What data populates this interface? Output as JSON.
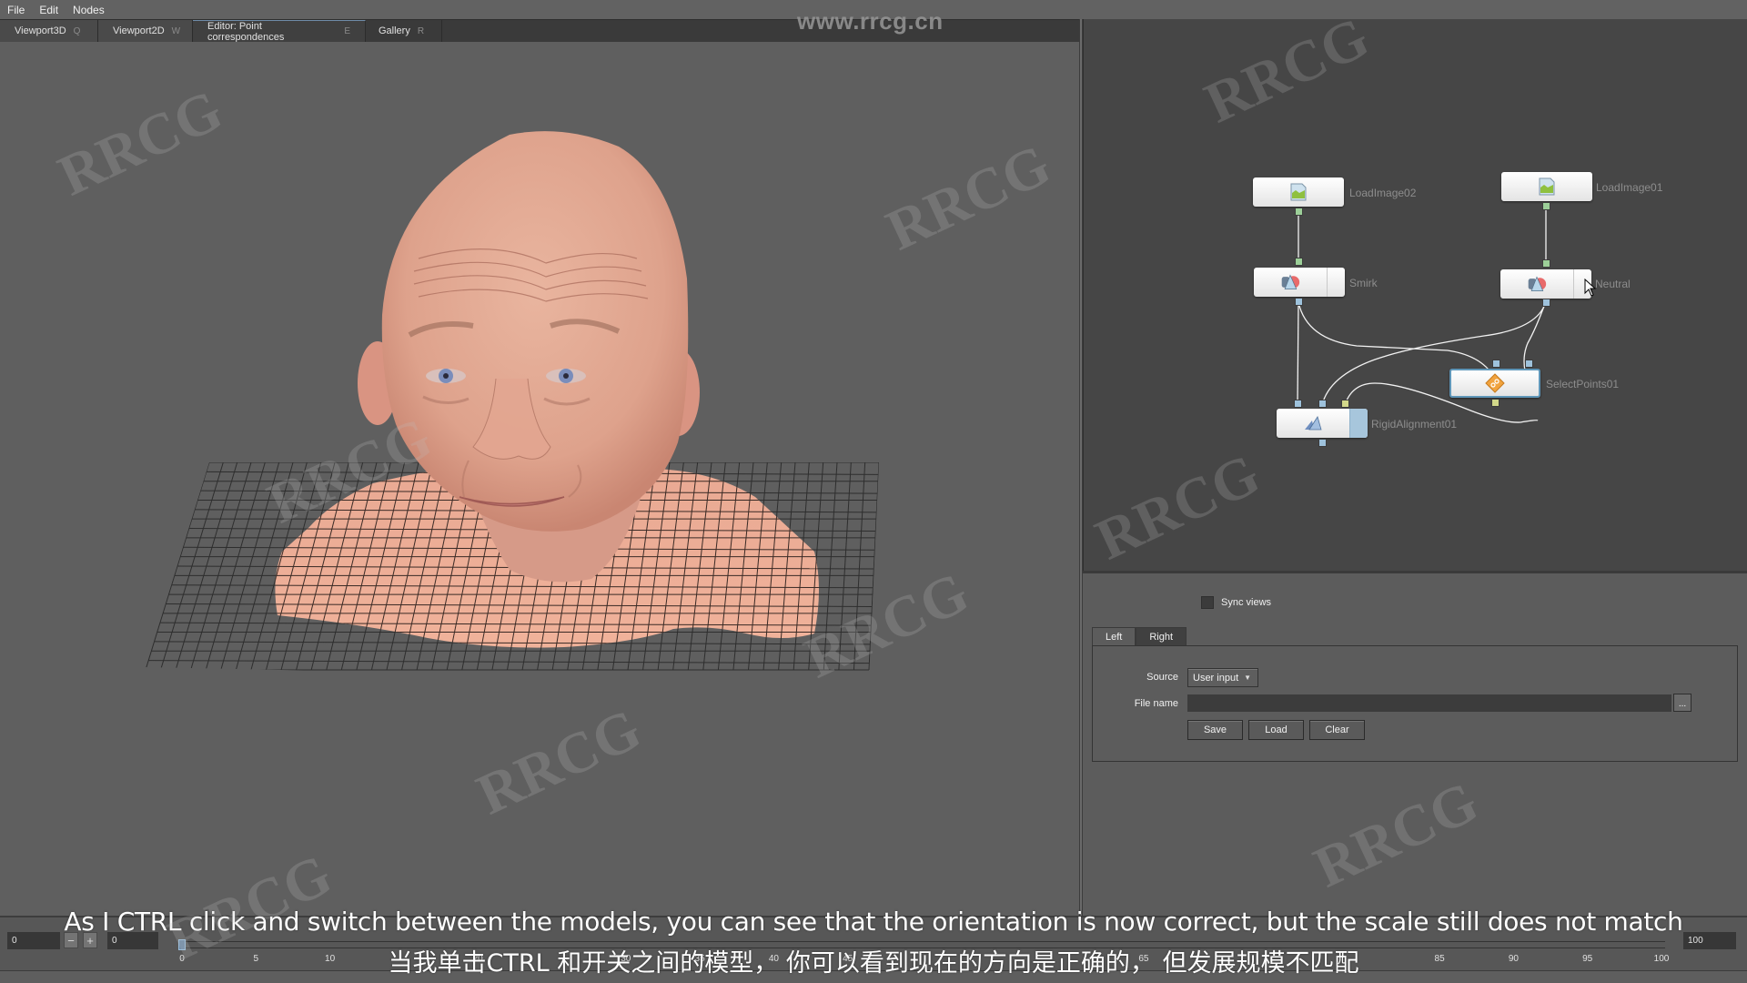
{
  "menu": {
    "items": [
      "File",
      "Edit",
      "Nodes"
    ]
  },
  "tabs": [
    {
      "label": "Viewport3D",
      "hotkey": "Q"
    },
    {
      "label": "Viewport2D",
      "hotkey": "W"
    },
    {
      "label": "Editor: Point correspondences",
      "hotkey": "E"
    },
    {
      "label": "Gallery",
      "hotkey": "R"
    }
  ],
  "watermark_url": "www.rrcg.cn",
  "node_editor": {
    "nodes": [
      {
        "name": "LoadImage02",
        "type": "load-image"
      },
      {
        "name": "LoadImage01",
        "type": "load-image"
      },
      {
        "name": "Smirk",
        "type": "mesh"
      },
      {
        "name": "Neutral",
        "type": "mesh"
      },
      {
        "name": "SelectPoints01",
        "type": "select-points"
      },
      {
        "name": "RigidAlignment01",
        "type": "rigid-alignment"
      }
    ],
    "colors": {
      "port_image": "#9ccf98",
      "port_mesh": "#9ec2dc",
      "port_points": "#d2d88a",
      "selected_border": "#5f96b8"
    }
  },
  "settings": {
    "sync_views_label": "Sync views",
    "sync_views_checked": false,
    "tabs": [
      "Left",
      "Right"
    ],
    "active_tab": "Left",
    "source_label": "Source",
    "source_value": "User input",
    "file_name_label": "File name",
    "file_name_value": "",
    "browse_label": "...",
    "buttons": {
      "save": "Save",
      "load": "Load",
      "clear": "Clear"
    }
  },
  "timeline": {
    "start_field": "0",
    "current_field": "0",
    "end_field": "100",
    "current_frame_label": "0",
    "range": [
      0,
      100
    ],
    "current_frame": 0,
    "tick_labels": [
      "0",
      "5",
      "10",
      "20",
      "30",
      "35",
      "40",
      "45",
      "65",
      "85",
      "90",
      "95",
      "100"
    ],
    "minus_label": "−",
    "plus_label": "+"
  },
  "subtitles": {
    "en": "As I CTRL click and switch between the models, you can see that the orientation is now correct, but the scale still does not match",
    "zh": "当我单击CTRL 和开关之间的模型， 你可以看到现在的方向是正确的， 但发展规模不匹配"
  }
}
